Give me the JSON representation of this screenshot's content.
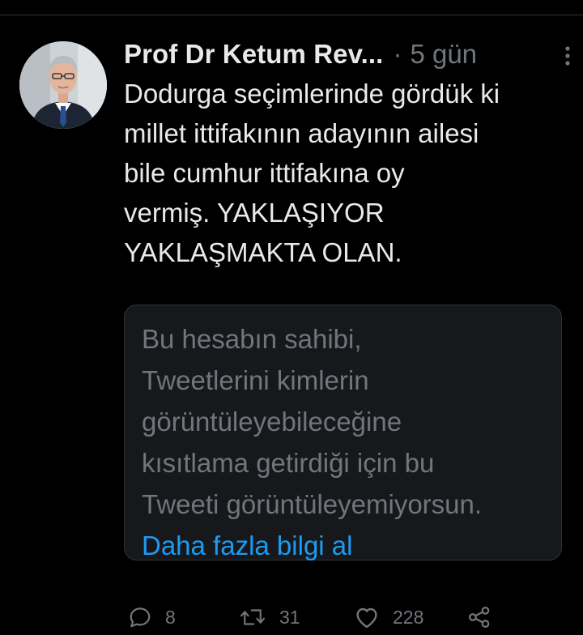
{
  "tweet": {
    "author_name": "Prof Dr Ketum Rev...",
    "separator": "·",
    "timestamp": "5 gün",
    "text": "Dodurga seçimlerinde gördük ki\nmillet ittifakının adayının ailesi\nbile cumhur ittifakına oy\nvermiş. YAKLAŞIYOR\nYAKLAŞMAKTA OLAN.",
    "restricted_notice": {
      "text": "Bu hesabın sahibi,\nTweetlerini kimlerin\ngörüntüleyebileceğine\nkısıtlama getirdiği için bu\nTweeti görüntüleyemiyorsun.",
      "link_label": "Daha fazla bilgi al"
    },
    "actions": {
      "reply_count": "8",
      "retweet_count": "31",
      "like_count": "228"
    }
  },
  "icons": {
    "more": "more-vertical-icon",
    "reply": "reply-bubble-icon",
    "retweet": "retweet-arrows-icon",
    "like": "heart-outline-icon",
    "share": "share-nodes-icon"
  },
  "colors": {
    "background": "#000000",
    "text_primary": "#e7e9ea",
    "text_secondary": "#71767b",
    "link": "#1d9bf0",
    "notice_background": "#16181c",
    "border": "#2f3336"
  }
}
